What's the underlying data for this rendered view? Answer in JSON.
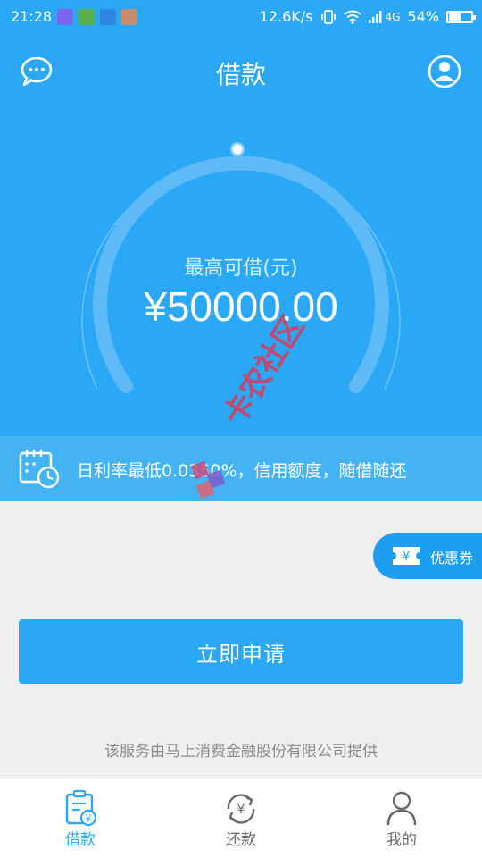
{
  "status_bar": {
    "time": "21:28",
    "net_speed": "12.6K/s",
    "net_type": "4G",
    "battery": "54%",
    "battery_level": 0.54,
    "notif_icon_colors": [
      "#7a64f0",
      "#59b04a",
      "#2f86e0",
      "#c98b6a"
    ]
  },
  "header": {
    "title": "借款",
    "left_icon": "chat-bubble-icon",
    "right_icon": "user-profile-icon"
  },
  "gauge": {
    "label": "最高可借(元)",
    "amount": "¥50000.00"
  },
  "promo": {
    "icon": "calendar-clock-icon",
    "text": "日利率最低0.0350%，信用额度，随借随还"
  },
  "coupon": {
    "icon": "ticket-yen-icon",
    "label": "优惠券"
  },
  "apply_button": {
    "label": "立即申请"
  },
  "provider_note": "该服务由马上消费金融股份有限公司提供",
  "nav": {
    "items": [
      {
        "label": "借款",
        "icon": "loan-document-icon",
        "active": true
      },
      {
        "label": "还款",
        "icon": "repay-cycle-icon",
        "active": false
      },
      {
        "label": "我的",
        "icon": "person-icon",
        "active": false
      }
    ]
  },
  "watermark": {
    "text": "卡农社区"
  },
  "colors": {
    "primary": "#2aa7f5",
    "strip": "#45b2f4",
    "coupon": "#1e9ef0",
    "background": "#efefef",
    "muted_text": "#8c8c8c"
  }
}
